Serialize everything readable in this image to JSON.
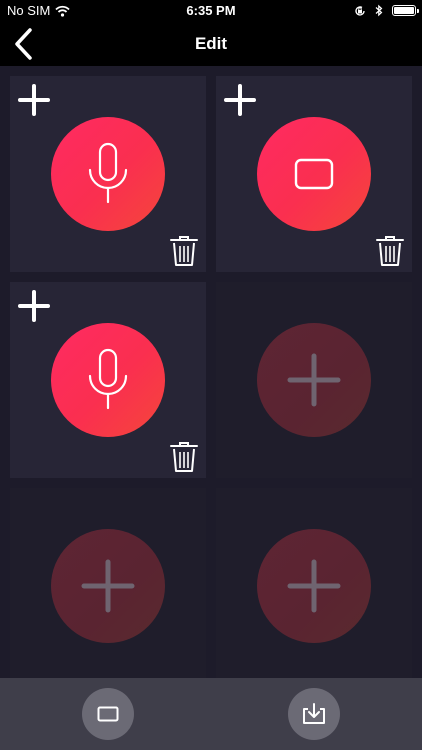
{
  "status_bar": {
    "carrier": "No SIM",
    "time": "6:35 PM",
    "icons": [
      "wifi-icon",
      "orientation-lock-icon",
      "bluetooth-icon",
      "battery-icon"
    ]
  },
  "nav": {
    "title": "Edit",
    "back_icon": "chevron-left-icon"
  },
  "tiles": [
    {
      "state": "filled",
      "icon": "microphone-icon",
      "has_add": true,
      "has_delete": true
    },
    {
      "state": "filled",
      "icon": "rectangle-icon",
      "has_add": true,
      "has_delete": true
    },
    {
      "state": "filled",
      "icon": "microphone-icon",
      "has_add": true,
      "has_delete": true
    },
    {
      "state": "empty",
      "icon": "plus-icon",
      "has_add": false,
      "has_delete": false
    },
    {
      "state": "empty",
      "icon": "plus-icon",
      "has_add": false,
      "has_delete": false
    },
    {
      "state": "empty",
      "icon": "plus-icon",
      "has_add": false,
      "has_delete": false
    }
  ],
  "bottom_bar": {
    "buttons": [
      "rectangle-icon",
      "download-tray-icon"
    ]
  },
  "colors": {
    "accent_start": "#ff2a62",
    "accent_end": "#f4473a",
    "background": "#1d1b2a",
    "tile_filled": "#272536",
    "bottom_bar": "#3f3e4a"
  }
}
